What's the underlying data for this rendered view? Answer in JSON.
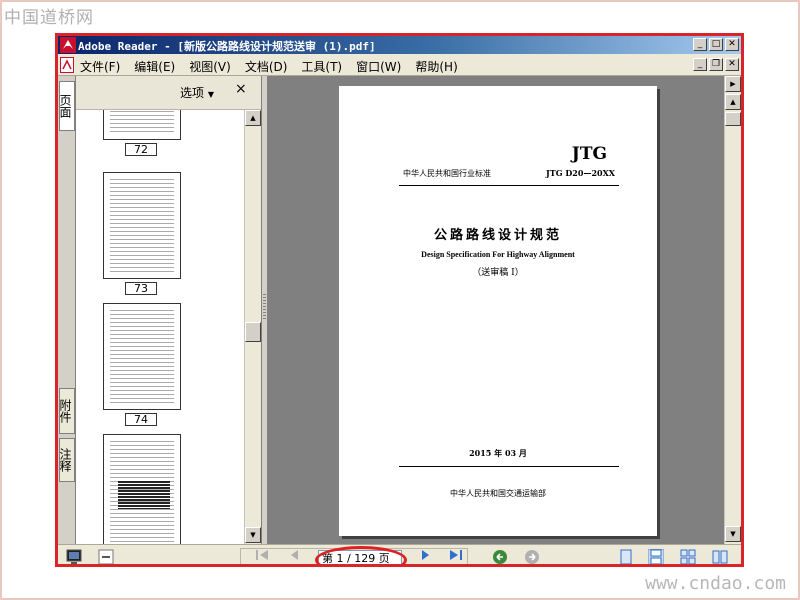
{
  "watermarks": {
    "top": "中国道桥网",
    "bottom": "www.cndao.com"
  },
  "window": {
    "title": "Adobe Reader - [新版公路路线设计规范送审 (1).pdf]"
  },
  "menu": [
    "文件(F)",
    "编辑(E)",
    "视图(V)",
    "文档(D)",
    "工具(T)",
    "窗口(W)",
    "帮助(H)"
  ],
  "side_tabs": {
    "pages": "页面",
    "attachments": "附件",
    "comments": "注释"
  },
  "panel": {
    "options_label": "选项",
    "close": "×"
  },
  "thumbnails": [
    {
      "label": "72"
    },
    {
      "label": "73"
    },
    {
      "label": "74"
    }
  ],
  "document_page": {
    "jtg": "JTG",
    "org": "中华人民共和国行业标准",
    "code": "JTG D20—20XX",
    "title": "公路路线设计规范",
    "title_en": "Design Specification For Highway Alignment",
    "draft": "（送审稿 Ⅰ）",
    "date": "2015 年 03 月",
    "publisher": "中华人民共和国交通运输部"
  },
  "status": {
    "page_indicator": "第 1 / 129 页"
  },
  "colors": {
    "highlight": "#e02020",
    "frame": "#d9252a",
    "title_gradient_start": "#0a246a",
    "nav_blue": "#2f6fd0",
    "nav_green": "#3a8a3a"
  }
}
